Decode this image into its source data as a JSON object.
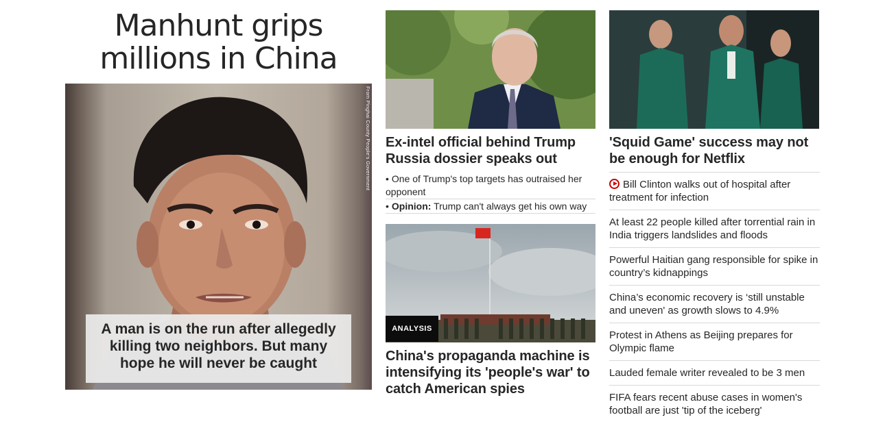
{
  "lead": {
    "headline": "Manhunt grips millions in China",
    "caption": "A man is on the run after allegedly killing two neighbors. But many hope he will never be caught",
    "credit": "From Pinghai County People's Government"
  },
  "card_dossier": {
    "headline": "Ex-intel official behind Trump Russia dossier speaks out",
    "bullets": [
      {
        "prefix": "",
        "text": "One of Trump's top targets has outraised her opponent"
      },
      {
        "prefix": "Opinion:",
        "text": "Trump can't always get his own way"
      }
    ]
  },
  "card_china": {
    "label": "ANALYSIS",
    "headline": "China's propaganda machine is intensifying its 'people's war' to catch American spies"
  },
  "card_squid": {
    "headline": "'Squid Game' success may not be enough for Netflix",
    "links": [
      {
        "text": "Bill Clinton walks out of hospital after treatment for infection",
        "video": true
      },
      {
        "text": "At least 22 people killed after torrential rain in India triggers landslides and floods"
      },
      {
        "text": "Powerful Haitian gang responsible for spike in country’s kidnappings"
      },
      {
        "text": "China’s economic recovery is ‘still unstable and uneven' as growth slows to 4.9%"
      },
      {
        "text": "Protest in Athens as Beijing prepares for Olympic flame"
      },
      {
        "text": "Lauded female writer revealed to be 3 men"
      },
      {
        "text": "FIFA fears recent abuse cases in women's football are just 'tip of the iceberg'"
      }
    ]
  },
  "colors": {
    "text": "#262626",
    "divider": "#d8d8d8",
    "label_bg": "#0c0c0c",
    "video_red": "#cc0000"
  }
}
